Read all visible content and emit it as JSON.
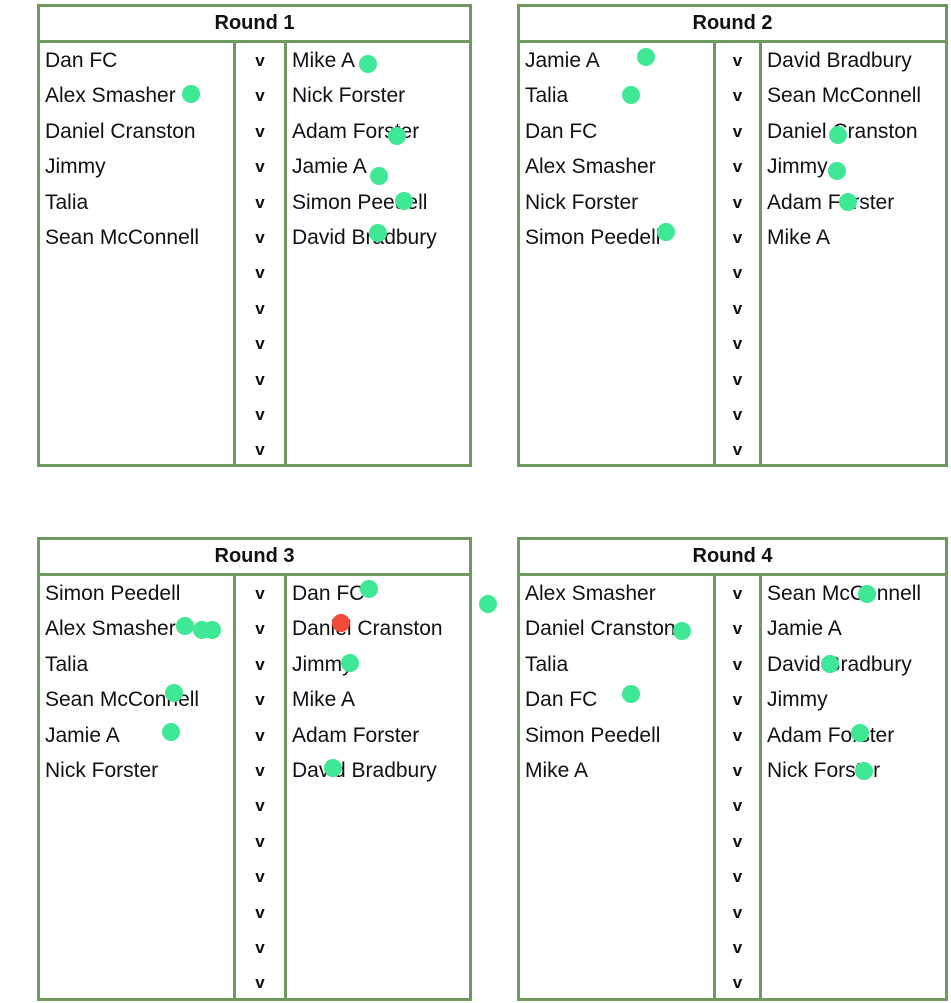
{
  "versus_label": "v",
  "rounds": [
    {
      "title": "Round 1",
      "home": [
        "Dan FC",
        "Alex Smasher",
        "Daniel Cranston",
        "Jimmy",
        "Talia",
        "Sean McConnell"
      ],
      "away": [
        "Mike A",
        "Nick Forster",
        "Adam Forster",
        "Jamie A",
        "Simon Peedell",
        "David Bradbury"
      ],
      "rows": 12
    },
    {
      "title": "Round 2",
      "home": [
        "Jamie A",
        "Talia",
        "Dan FC",
        "Alex Smasher",
        "Nick Forster",
        "Simon Peedell"
      ],
      "away": [
        "David Bradbury",
        "Sean McConnell",
        "Daniel Cranston",
        "Jimmy",
        "Adam Forster",
        "Mike A"
      ],
      "rows": 12
    },
    {
      "title": "Round 3",
      "home": [
        "Simon Peedell",
        "Alex Smasher",
        "Talia",
        "Sean McConnell",
        "Jamie A",
        "Nick Forster"
      ],
      "away": [
        "Dan FC",
        "Daniel Cranston",
        "Jimmy",
        "Mike A",
        "Adam Forster",
        "David Bradbury"
      ],
      "rows": 12
    },
    {
      "title": "Round 4",
      "home": [
        "Alex Smasher",
        "Daniel Cranston",
        "Talia",
        "Dan FC",
        "Simon Peedell",
        "Mike A"
      ],
      "away": [
        "Sean McConnell",
        "Jamie A",
        "David Bradbury",
        "Jimmy",
        "Adam Forster",
        "Nick Forster"
      ],
      "rows": 12
    }
  ],
  "marker_colors": {
    "green": "#3ee895",
    "red": "#f24a3a"
  }
}
